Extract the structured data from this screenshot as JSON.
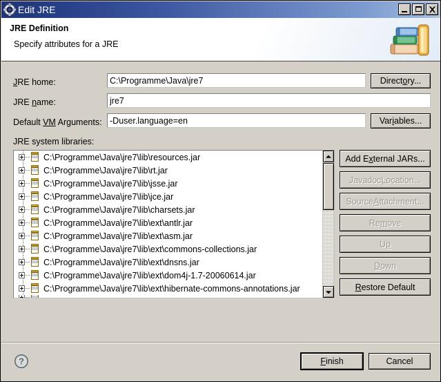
{
  "window": {
    "title": "Edit JRE",
    "icon": "gear-icon",
    "minimize_label": "_",
    "maximize_label": "□",
    "close_label": "✕",
    "titlebar_gradient_start": "#1f3575",
    "titlebar_gradient_end": "#b9c7d8"
  },
  "header": {
    "title": "JRE Definition",
    "description": "Specify attributes for a JRE",
    "icon": "books-icon"
  },
  "form": {
    "jre_home": {
      "label_prefix": "",
      "label_mnemonic": "J",
      "label_suffix": "RE home:",
      "value": "C:\\Programme\\Java\\jre7",
      "button": {
        "prefix": "Direct",
        "mnemonic": "o",
        "suffix": "ry..."
      }
    },
    "jre_name": {
      "label_prefix": "JRE ",
      "label_mnemonic": "n",
      "label_suffix": "ame:",
      "value": "jre7"
    },
    "vm_arguments": {
      "label_prefix": "Default ",
      "label_mnemonic": "VM",
      "label_suffix": " Arguments:",
      "value": "-Duser.language=en",
      "button": {
        "prefix": "Var",
        "mnemonic": "i",
        "suffix": "ables..."
      }
    },
    "libraries_label": "JRE system libraries:"
  },
  "libraries": [
    {
      "path": "C:\\Programme\\Java\\jre7\\lib\\resources.jar",
      "icon": "jar-icon",
      "expandable": true
    },
    {
      "path": "C:\\Programme\\Java\\jre7\\lib\\rt.jar",
      "icon": "jar-icon",
      "expandable": true
    },
    {
      "path": "C:\\Programme\\Java\\jre7\\lib\\jsse.jar",
      "icon": "jar-icon",
      "expandable": true
    },
    {
      "path": "C:\\Programme\\Java\\jre7\\lib\\jce.jar",
      "icon": "jar-icon",
      "expandable": true
    },
    {
      "path": "C:\\Programme\\Java\\jre7\\lib\\charsets.jar",
      "icon": "jar-icon",
      "expandable": true
    },
    {
      "path": "C:\\Programme\\Java\\jre7\\lib\\ext\\antlr.jar",
      "icon": "jar-icon",
      "expandable": true
    },
    {
      "path": "C:\\Programme\\Java\\jre7\\lib\\ext\\asm.jar",
      "icon": "jar-icon",
      "expandable": true
    },
    {
      "path": "C:\\Programme\\Java\\jre7\\lib\\ext\\commons-collections.jar",
      "icon": "jar-icon",
      "expandable": true
    },
    {
      "path": "C:\\Programme\\Java\\jre7\\lib\\ext\\dnsns.jar",
      "icon": "jar-icon",
      "expandable": true
    },
    {
      "path": "C:\\Programme\\Java\\jre7\\lib\\ext\\dom4j-1.7-20060614.jar",
      "icon": "jar-icon",
      "expandable": true
    },
    {
      "path": "C:\\Programme\\Java\\jre7\\lib\\ext\\hibernate-commons-annotations.jar",
      "icon": "jar-icon",
      "expandable": true
    }
  ],
  "side_buttons": [
    {
      "prefix": "Add E",
      "mnemonic": "x",
      "suffix": "ternal JARs...",
      "enabled": true
    },
    {
      "prefix": "Javadoc ",
      "mnemonic": "L",
      "suffix": "ocation...",
      "enabled": false
    },
    {
      "prefix": "Source ",
      "mnemonic": "A",
      "suffix": "ttachment...",
      "enabled": false
    },
    {
      "prefix": "Re",
      "mnemonic": "m",
      "suffix": "ove",
      "enabled": false
    },
    {
      "prefix": "U",
      "mnemonic": "p",
      "suffix": "",
      "enabled": false
    },
    {
      "prefix": "",
      "mnemonic": "D",
      "suffix": "own",
      "enabled": false
    },
    {
      "prefix": "",
      "mnemonic": "R",
      "suffix": "estore Default",
      "enabled": true
    }
  ],
  "scrollbar": {
    "up_arrow": "scroll-up-arrow",
    "down_arrow": "scroll-down-arrow"
  },
  "footer": {
    "help_icon": "help-question-icon",
    "finish": {
      "prefix": "",
      "mnemonic": "F",
      "suffix": "inish",
      "default": true
    },
    "cancel": {
      "prefix": "Cancel",
      "mnemonic": "",
      "suffix": "",
      "default": false
    }
  }
}
